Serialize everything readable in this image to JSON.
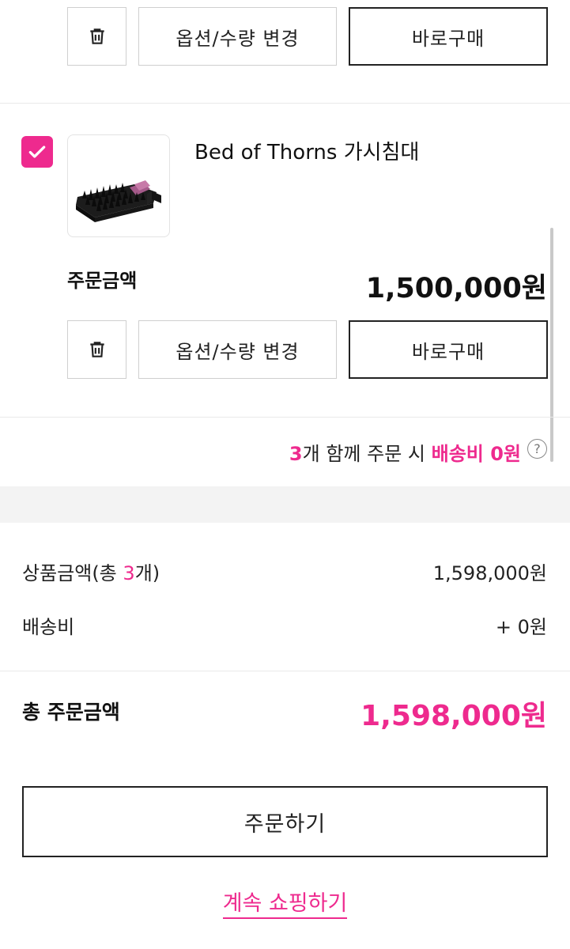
{
  "item_actions": {
    "option_label": "옵션/수량 변경",
    "buy_now_label": "바로구매"
  },
  "product": {
    "name": "Bed of Thorns 가시침대",
    "image_icon": "thorn-bed-product-image",
    "checked": true,
    "order_amount_label": "주문금액",
    "order_amount_value": "1,500,000원"
  },
  "shipping_notice": {
    "count": "3",
    "text_mid": "개 함께 주문 시 ",
    "highlight": "배송비 0원",
    "help_icon": "question-circle-icon"
  },
  "summary": {
    "product_total_label_prefix": "상품금액(총 ",
    "product_total_count": "3",
    "product_total_label_suffix": "개)",
    "product_total_value": "1,598,000원",
    "shipping_label": "배송비",
    "shipping_value": "+ 0원",
    "grand_total_label": "총 주문금액",
    "grand_total_value": "1,598,000원"
  },
  "order_button_label": "주문하기",
  "continue_shopping_label": "계속 쇼핑하기",
  "colors": {
    "accent": "#ee2a8e",
    "border": "#cfcfcf",
    "band": "#f3f3f3"
  }
}
